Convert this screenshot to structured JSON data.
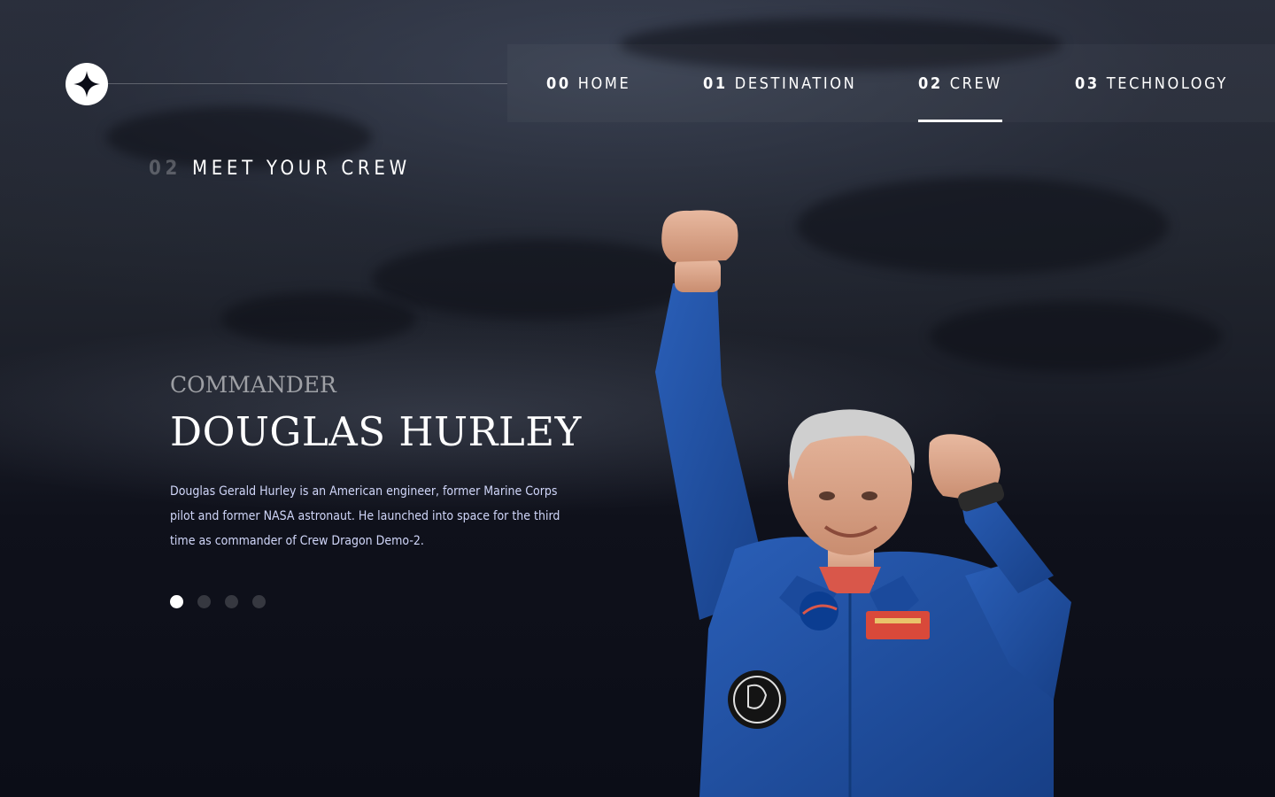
{
  "nav": {
    "items": [
      {
        "num": "00",
        "label": "HOME"
      },
      {
        "num": "01",
        "label": "DESTINATION"
      },
      {
        "num": "02",
        "label": "CREW",
        "active": true
      },
      {
        "num": "03",
        "label": "TECHNOLOGY"
      }
    ]
  },
  "page": {
    "heading_num": "02",
    "heading_text": "MEET YOUR CREW"
  },
  "crew": {
    "role": "COMMANDER",
    "name": "DOUGLAS HURLEY",
    "bio": "Douglas Gerald Hurley is an American engineer, former Marine Corps pilot and former NASA astronaut. He launched into space for the third time as commander of Crew Dragon Demo-2.",
    "active_index": 0,
    "count": 4
  },
  "icons": {
    "logo": "star-logo-icon"
  },
  "colors": {
    "background": "#0b0d17",
    "text": "#ffffff",
    "body_text": "#d0d6f9",
    "suit": "#1f4fa3"
  }
}
